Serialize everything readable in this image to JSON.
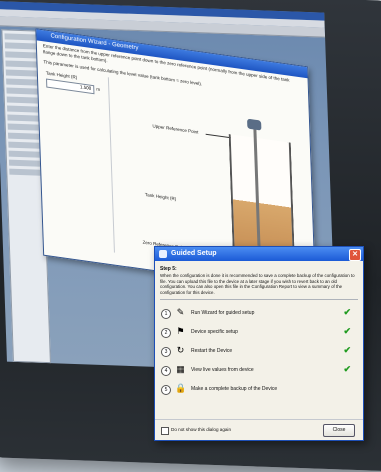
{
  "wizard": {
    "title": "Configuration Wizard - Geometry",
    "description": "Enter the distance from the upper reference point down to the zero reference point (normally from the upper side of the tank flange down to the tank bottom).",
    "note": "This parameter is used for calculating the level value (tank bottom = zero level).",
    "tank_height_label": "Tank Height (R)",
    "tank_height_value": "1.500",
    "tank_height_unit": "m",
    "labels": {
      "upper": "Upper Reference Point",
      "tank_height": "Tank Height (R)",
      "zero": "Zero Reference Point"
    }
  },
  "guided": {
    "title": "Guided Setup",
    "step": "Step 5:",
    "description": "When the configuration is done it is recommended to save a complete backup of the configuration to file. You can upload this file to the device at a later stage if you wish to revert back to an old configuration. You can also open this file in the Configuration Report to view a summary of the configuration for this device.",
    "items": [
      {
        "num": "1",
        "label": "Run Wizard for guided setup",
        "icon": "wizard-icon",
        "glyph": "✎",
        "done": true
      },
      {
        "num": "2",
        "label": "Device specific setup",
        "icon": "probe-icon",
        "glyph": "⚑",
        "done": true
      },
      {
        "num": "3",
        "label": "Restart the Device",
        "icon": "restart-icon",
        "glyph": "↻",
        "done": true
      },
      {
        "num": "4",
        "label": "View live values from device",
        "icon": "live-values-icon",
        "glyph": "▦",
        "done": true
      },
      {
        "num": "5",
        "label": "Make a complete backup of the Device",
        "icon": "backup-icon",
        "glyph": "🔒",
        "done": false
      }
    ],
    "checkmark": "✔",
    "dont_show": "Do not show this dialog again",
    "close_label": "Close"
  }
}
